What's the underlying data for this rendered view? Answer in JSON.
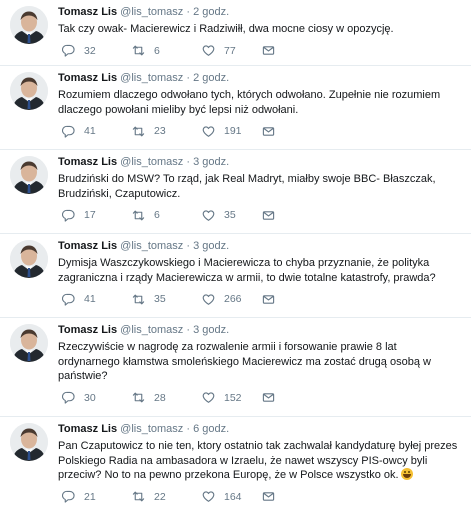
{
  "tweets": [
    {
      "name": "Tomasz Lis",
      "handle": "@lis_tomasz",
      "time": "2 godz.",
      "text": "Tak czy owak- Macierewicz i Radziwiłł, dwa mocne ciosy w opozycję.",
      "replies": "32",
      "retweets": "6",
      "likes": "77"
    },
    {
      "name": "Tomasz Lis",
      "handle": "@lis_tomasz",
      "time": "2 godz.",
      "text": "Rozumiem dlaczego odwołano tych, których odwołano. Zupełnie nie rozumiem dlaczego powołani mieliby być lepsi niż odwołani.",
      "replies": "41",
      "retweets": "23",
      "likes": "191"
    },
    {
      "name": "Tomasz Lis",
      "handle": "@lis_tomasz",
      "time": "3 godz.",
      "text": "Brudziński do MSW? To rząd, jak Real Madryt, miałby swoje BBC- Błaszczak, Brudziński, Czaputowicz.",
      "replies": "17",
      "retweets": "6",
      "likes": "35"
    },
    {
      "name": "Tomasz Lis",
      "handle": "@lis_tomasz",
      "time": "3 godz.",
      "text": "Dymisja Waszczykowskiego i Macierewicza to chyba przyznanie, że polityka zagraniczna i rządy Macierewicza w armii, to dwie totalne katastrofy, prawda?",
      "replies": "41",
      "retweets": "35",
      "likes": "266"
    },
    {
      "name": "Tomasz Lis",
      "handle": "@lis_tomasz",
      "time": "3 godz.",
      "text": "Rzeczywiście w nagrodę za rozwalenie armii i forsowanie prawie 8 lat ordynarnego kłamstwa smoleńskiego Macierewicz ma zostać drugą osobą w państwie?",
      "replies": "30",
      "retweets": "28",
      "likes": "152"
    },
    {
      "name": "Tomasz Lis",
      "handle": "@lis_tomasz",
      "time": "6 godz.",
      "text": "Pan Czaputowicz to nie ten, ktory ostatnio tak zachwalał kandydaturę byłej prezes Polskiego Radia na ambasadora w Izraelu, że nawet wszyscy PIS-owcy byli przeciw? No to na pewno przekona Europę, że w Polsce wszystko ok.",
      "replies": "21",
      "retweets": "22",
      "likes": "164",
      "emoji": "grinning-face-emoji"
    }
  ]
}
